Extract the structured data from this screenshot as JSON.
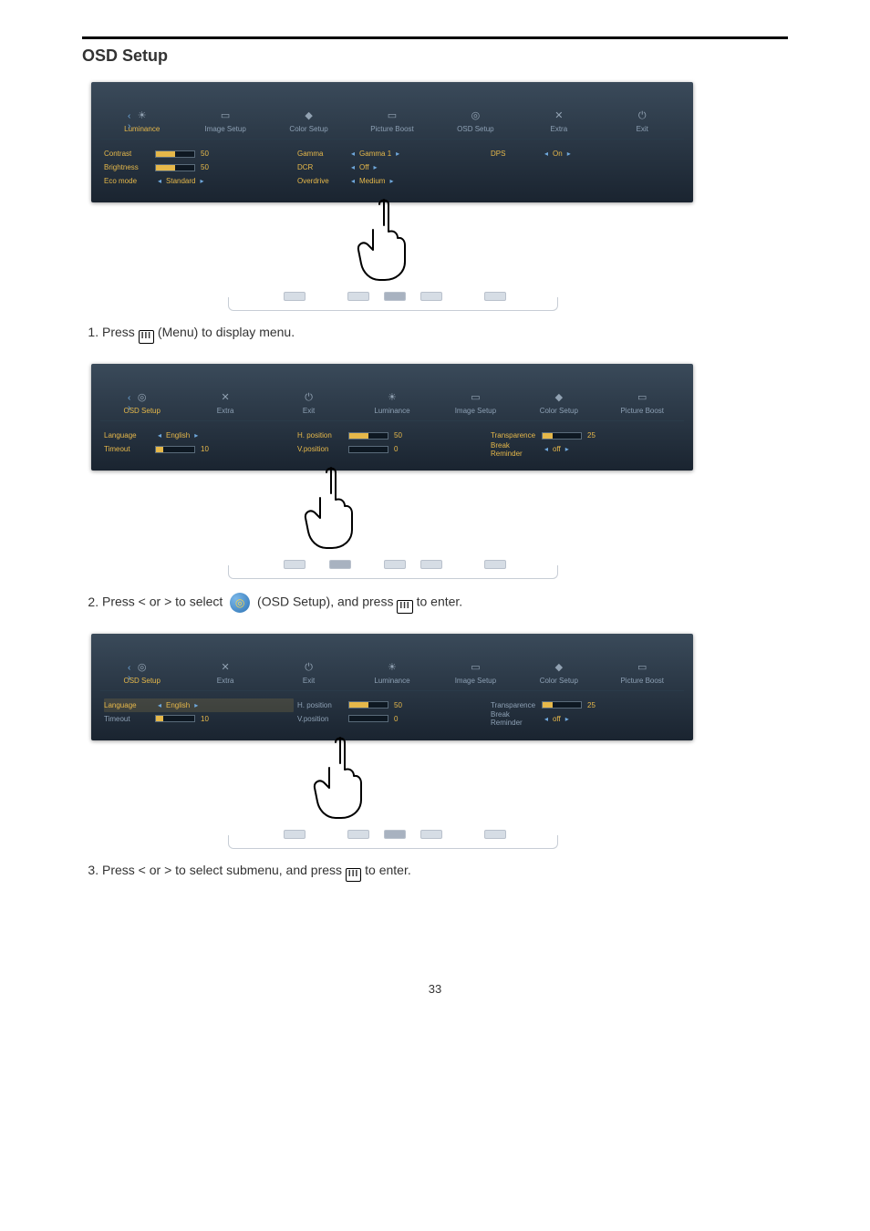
{
  "page_number": "33",
  "heading": "OSD Setup",
  "steps": [
    {
      "before": "Press ",
      "icon": "menu",
      "after": " (Menu) to display menu."
    },
    {
      "before": "Press < or > to select ",
      "icon": "osd",
      "after": " (OSD Setup), and press ",
      "icon2": "menu",
      "after2": " to enter."
    },
    {
      "before": "Press < or > to select submenu, and press ",
      "icon": "menu",
      "after": "  to enter."
    }
  ],
  "osd1": {
    "tabs": [
      "Luminance",
      "Image Setup",
      "Color Setup",
      "Picture Boost",
      "OSD Setup",
      "Extra",
      "Exit"
    ],
    "col1": [
      {
        "label": "Contrast",
        "value": "50",
        "fill": 50
      },
      {
        "label": "Brightness",
        "value": "50",
        "fill": 50
      },
      {
        "label": "Eco mode",
        "select": "Standard"
      }
    ],
    "col2": [
      {
        "label": "Gamma",
        "select": "Gamma 1"
      },
      {
        "label": "DCR",
        "select": "Off"
      },
      {
        "label": "Overdrive",
        "select": "Medium"
      }
    ],
    "col3": [
      {
        "label": "DPS",
        "select": "On"
      }
    ]
  },
  "osd2": {
    "tabs": [
      "OSD Setup",
      "Extra",
      "Exit",
      "Luminance",
      "Image Setup",
      "Color Setup",
      "Picture Boost"
    ],
    "col1": [
      {
        "label": "Language",
        "select": "English"
      },
      {
        "label": "Timeout",
        "value": "10",
        "fill": 20
      }
    ],
    "col2": [
      {
        "label": "H. position",
        "value": "50",
        "fill": 50
      },
      {
        "label": "V.position",
        "value": "0",
        "fill": 0
      }
    ],
    "col3": [
      {
        "label": "Transparence",
        "value": "25",
        "fill": 25
      },
      {
        "label": "Break Reminder",
        "select": "off"
      }
    ]
  },
  "osd3": {
    "tabs": [
      "OSD Setup",
      "Extra",
      "Exit",
      "Luminance",
      "Image Setup",
      "Color Setup",
      "Picture Boost"
    ],
    "col1": [
      {
        "label": "Language",
        "select": "English",
        "hl": true
      },
      {
        "label": "Timeout",
        "value": "10",
        "fill": 20
      }
    ],
    "col2": [
      {
        "label": "H. position",
        "value": "50",
        "fill": 50
      },
      {
        "label": "V.position",
        "value": "0",
        "fill": 0
      }
    ],
    "col3": [
      {
        "label": "Transparence",
        "value": "25",
        "fill": 25
      },
      {
        "label": "Break Reminder",
        "select": "off"
      }
    ]
  },
  "menu_glyph": "III"
}
